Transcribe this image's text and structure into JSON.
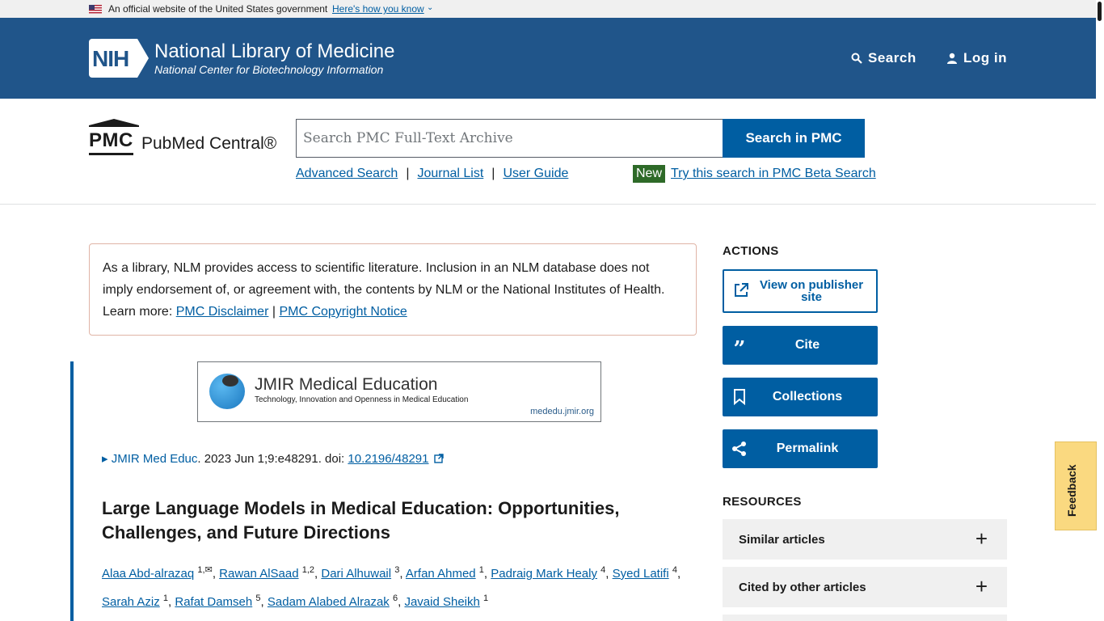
{
  "gov_banner": {
    "text": "An official website of the United States government",
    "link": "Here's how you know"
  },
  "nih_header": {
    "logo_text": "NIH",
    "title": "National Library of Medicine",
    "subtitle": "National Center for Biotechnology Information",
    "search_label": "Search",
    "login_label": "Log in"
  },
  "pmc_header": {
    "logo_abbr": "PMC",
    "logo_name": "PubMed Central®",
    "search_placeholder": "Search PMC Full-Text Archive",
    "search_button": "Search in PMC",
    "links": [
      "Advanced Search",
      "Journal List",
      "User Guide"
    ],
    "new_badge": "New",
    "beta_link": "Try this search in PMC Beta Search"
  },
  "disclaimer": {
    "text": "As a library, NLM provides access to scientific literature. Inclusion in an NLM database does not imply endorsement of, or agreement with, the contents by NLM or the National Institutes of Health.",
    "learn_more": "Learn more:",
    "link1": "PMC Disclaimer",
    "sep": "|",
    "link2": "PMC Copyright Notice"
  },
  "journal_banner": {
    "title": "JMIR Medical Education",
    "subtitle": "Technology, Innovation and Openness in Medical Education",
    "url": "mededu.jmir.org"
  },
  "citation": {
    "journal": "▸ JMIR Med Educ",
    "details": ". 2023 Jun 1;9:e48291. doi: ",
    "doi": "10.2196/48291"
  },
  "article": {
    "title": "Large Language Models in Medical Education: Opportunities, Challenges, and Future Directions",
    "authors": [
      {
        "name": "Alaa Abd-alrazaq",
        "aff": "1,✉"
      },
      {
        "name": "Rawan AlSaad",
        "aff": "1,2"
      },
      {
        "name": "Dari Alhuwail",
        "aff": "3"
      },
      {
        "name": "Arfan Ahmed",
        "aff": "1"
      },
      {
        "name": "Padraig Mark Healy",
        "aff": "4"
      },
      {
        "name": "Syed Latifi",
        "aff": "4"
      },
      {
        "name": "Sarah Aziz",
        "aff": "1"
      },
      {
        "name": "Rafat Damseh",
        "aff": "5"
      },
      {
        "name": "Sadam Alabed Alrazak",
        "aff": "6"
      },
      {
        "name": "Javaid Sheikh",
        "aff": "1"
      }
    ]
  },
  "sidebar": {
    "actions_heading": "ACTIONS",
    "view_publisher": "View on publisher site",
    "cite": "Cite",
    "collections": "Collections",
    "permalink": "Permalink",
    "resources_heading": "RESOURCES",
    "similar_articles": "Similar articles",
    "cited_by": "Cited by other articles"
  },
  "feedback": "Feedback",
  "colors": {
    "nih_blue": "#20558a",
    "action_blue": "#005ea2",
    "new_green": "#2e6a28",
    "feedback_yellow": "#fad980"
  }
}
